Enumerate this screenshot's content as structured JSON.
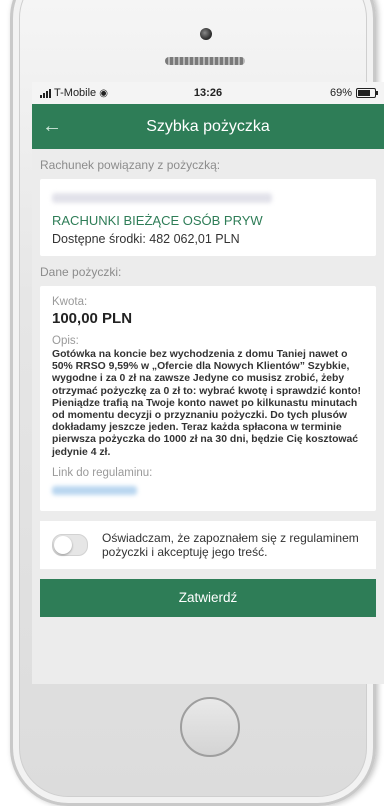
{
  "status_bar": {
    "carrier": "T-Mobile",
    "time": "13:26",
    "battery": "69%"
  },
  "header": {
    "back_icon": "arrow-left-icon",
    "title": "Szybka pożyczka"
  },
  "account_section": {
    "label": "Rachunek powiązany z pożyczką:",
    "account_name": "RACHUNKI BIEŻĄCE OSÓB PRYW",
    "available_funds": "Dostępne środki: 482 062,01 PLN"
  },
  "loan_section": {
    "label": "Dane pożyczki:",
    "amount_label": "Kwota:",
    "amount_value": "100,00 PLN",
    "description_label": "Opis:",
    "description": "Gotówka na koncie bez wychodzenia z domu Taniej nawet o 50% RRSO 9,59% w „Ofercie dla Nowych Klientów” Szybkie, wygodne i za 0 zł na zawsze Jedyne co musisz zrobić, żeby otrzymać pożyczkę za 0 zł to: wybrać kwotę i sprawdzić konto! Pieniądze trafią na Twoje konto nawet po kilkunastu minutach od momentu decyzji o przyznaniu pożyczki. Do tych plusów dokładamy jeszcze jeden. Teraz każda spłacona w terminie pierwsza pożyczka do 1000 zł na 30 dni, będzie Cię kosztować jedynie 4 zł.",
    "link_label": "Link do regulaminu:"
  },
  "consent": {
    "checked": false,
    "text": "Oświadczam, że zapoznałem się z regulaminem pożyczki i akceptuję jego treść."
  },
  "confirm_button": "Zatwierdź",
  "colors": {
    "brand_green": "#2e7d57",
    "screen_bg": "#ececec"
  }
}
